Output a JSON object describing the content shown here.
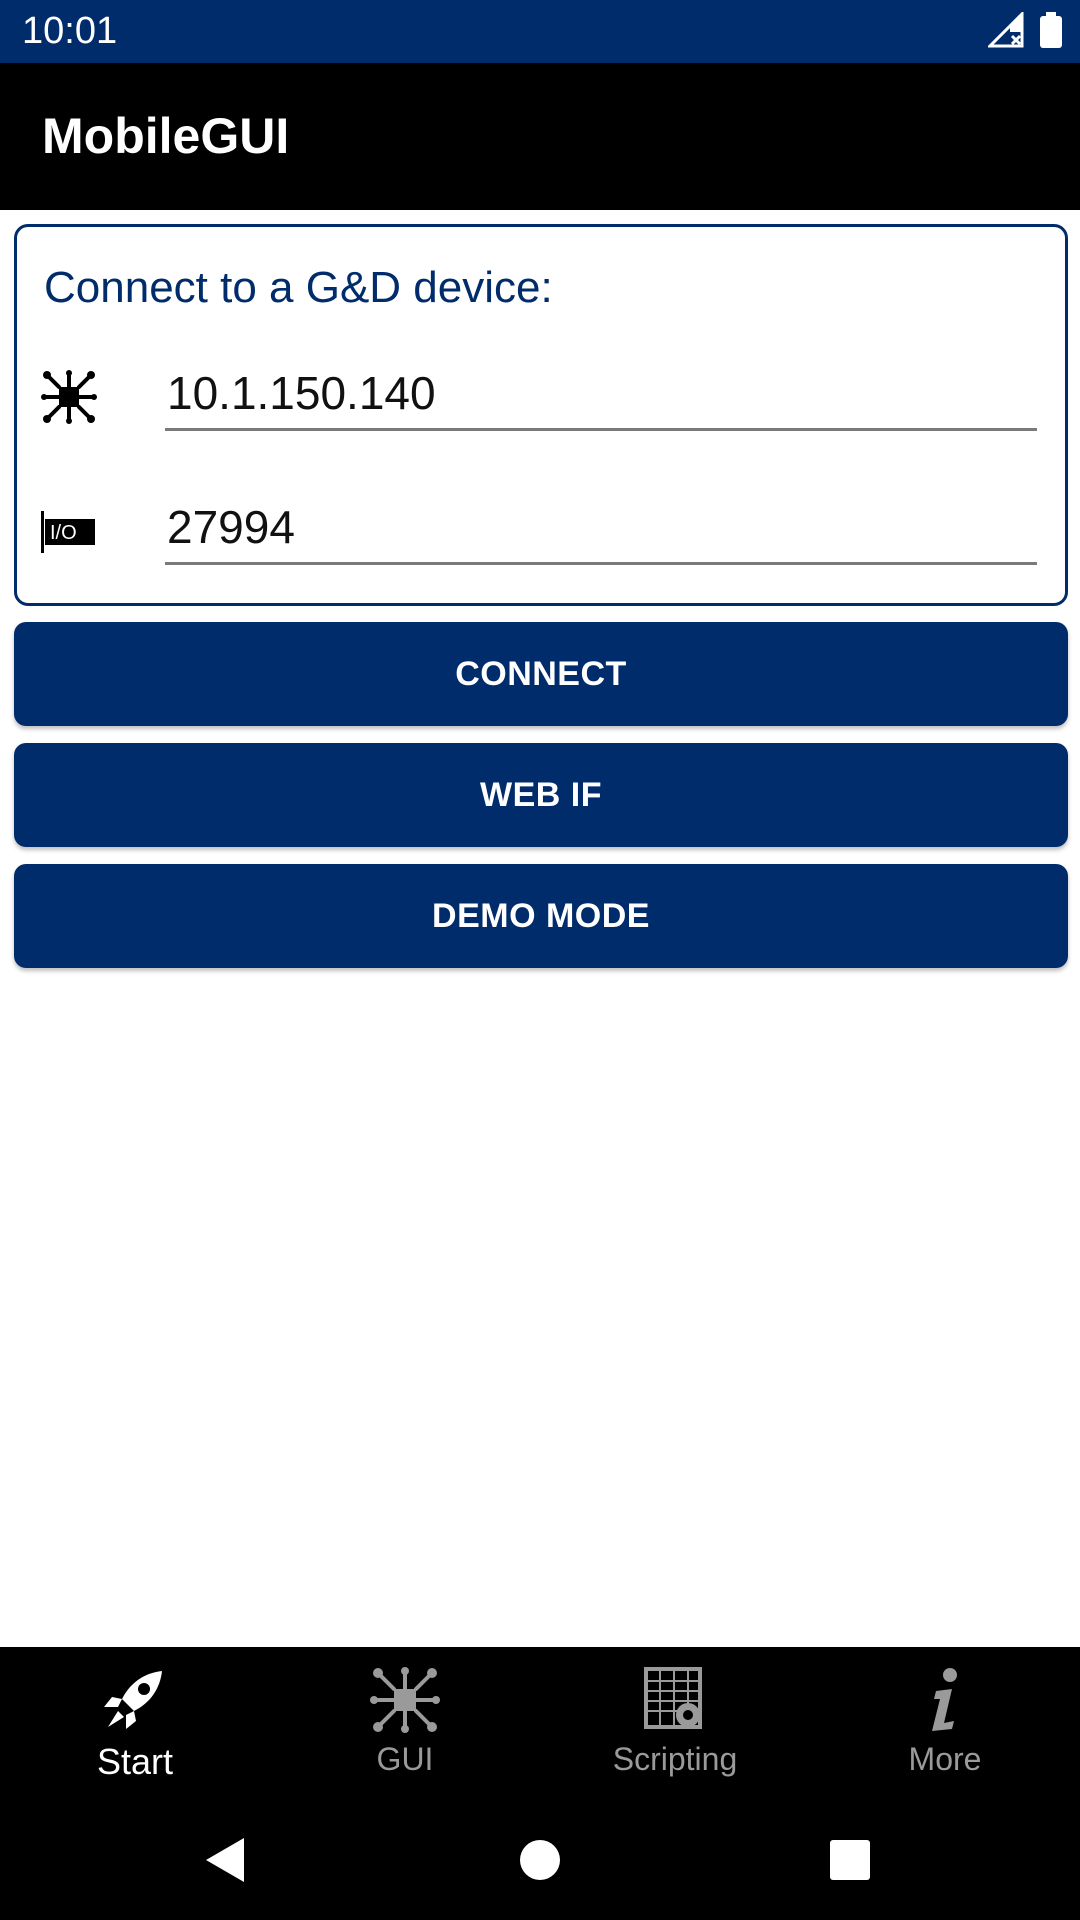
{
  "status_bar": {
    "time": "10:01",
    "icons": [
      "signal-no-data-icon",
      "battery-icon"
    ]
  },
  "app_bar": {
    "title": "MobileGUI"
  },
  "connect_card": {
    "title": "Connect to a G&D device:",
    "ip_field": {
      "icon": "network-device-icon",
      "value": "10.1.150.140"
    },
    "port_field": {
      "icon": "io-port-icon",
      "value": "27994"
    }
  },
  "buttons": {
    "connect": "CONNECT",
    "web_if": "WEB IF",
    "demo_mode": "DEMO MODE"
  },
  "bottom_nav": {
    "items": [
      {
        "label": "Start",
        "icon": "rocket-icon",
        "active": true
      },
      {
        "label": "GUI",
        "icon": "network-device-icon",
        "active": false
      },
      {
        "label": "Scripting",
        "icon": "script-gear-icon",
        "active": false
      },
      {
        "label": "More",
        "icon": "info-icon",
        "active": false
      }
    ]
  },
  "system_nav": [
    "back-icon",
    "home-icon",
    "recents-icon"
  ],
  "colors": {
    "primary": "#002c6b",
    "app_bar": "#000000",
    "inactive_nav": "#9a9a9a"
  }
}
